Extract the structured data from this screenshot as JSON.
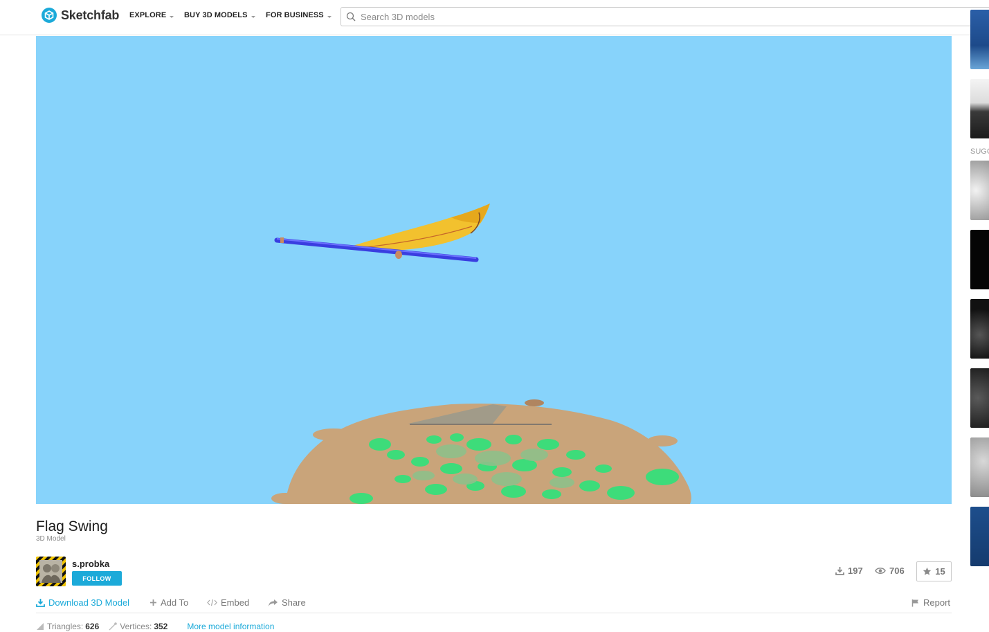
{
  "header": {
    "brand": "Sketchfab",
    "nav": [
      {
        "label": "EXPLORE"
      },
      {
        "label": "BUY 3D MODELS"
      },
      {
        "label": "FOR BUSINESS"
      }
    ],
    "search_placeholder": "Search 3D models"
  },
  "sidebar": {
    "section_label": "SUGG"
  },
  "model": {
    "title": "Flag Swing",
    "type": "3D Model",
    "author": "s.probka",
    "follow_label": "FOLLOW",
    "downloads": "197",
    "views": "706",
    "likes": "15"
  },
  "actions": {
    "download": "Download 3D Model",
    "add_to": "Add To",
    "embed": "Embed",
    "share": "Share",
    "report": "Report"
  },
  "meta": {
    "triangles_label": "Triangles:",
    "triangles": "626",
    "vertices_label": "Vertices:",
    "vertices": "352",
    "more_info": "More model information"
  },
  "colors": {
    "accent": "#1caad9",
    "sky": "#87d3fb",
    "flag": "#f2c12e",
    "pole": "#4a4ee8",
    "ground": "#c9a47a",
    "grass": "#3ddc7a"
  }
}
